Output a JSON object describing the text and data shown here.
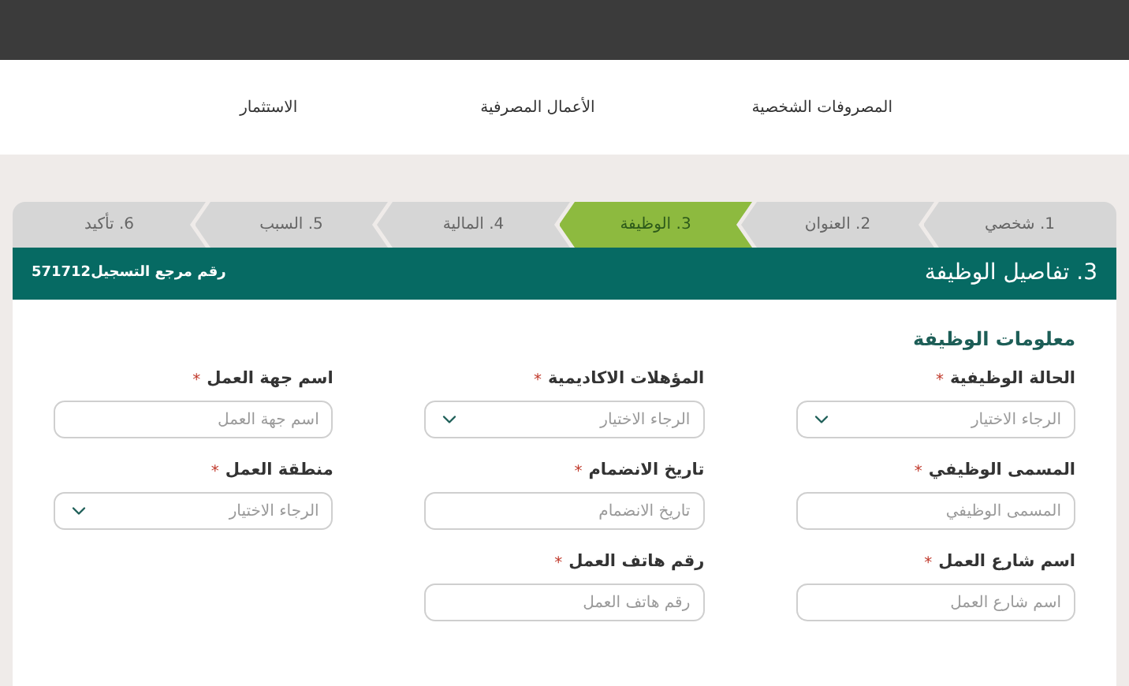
{
  "nav": [
    {
      "label": "المصروفات الشخصية"
    },
    {
      "label": "الأعمال المصرفية"
    },
    {
      "label": "الاستثمار"
    }
  ],
  "steps": [
    {
      "label": "1. شخصي",
      "selected": false
    },
    {
      "label": "2. العنوان",
      "selected": false
    },
    {
      "label": "3. الوظيفة",
      "selected": true
    },
    {
      "label": "4. المالية",
      "selected": false
    },
    {
      "label": "5. السبب",
      "selected": false
    },
    {
      "label": "6. تأكيد",
      "selected": false
    }
  ],
  "banner": {
    "title": "3. تفاصيل الوظيفة",
    "reference": "رقم مرجع التسجيل571712"
  },
  "section_title": "معلومات الوظيفة",
  "fields": [
    {
      "kind": "select",
      "label": "الحالة الوظيفية",
      "required_mark": "*",
      "placeholder": "الرجاء الاختيار"
    },
    {
      "kind": "select",
      "label": "المؤهلات الاكاديمية",
      "required_mark": "*",
      "placeholder": "الرجاء الاختيار"
    },
    {
      "kind": "text",
      "label": "اسم جهة العمل",
      "required_mark": "*",
      "placeholder": "اسم جهة العمل"
    },
    {
      "kind": "text",
      "label": "المسمى الوظيفي",
      "required_mark": "*",
      "placeholder": "المسمى الوظيفي"
    },
    {
      "kind": "text",
      "label": "تاريخ الانضمام",
      "required_mark": "*",
      "placeholder": "تاريخ الانضمام"
    },
    {
      "kind": "select",
      "label": "منطقة العمل",
      "required_mark": "*",
      "placeholder": "الرجاء الاختيار"
    },
    {
      "kind": "text",
      "label": "اسم شارع العمل",
      "required_mark": "*",
      "placeholder": "اسم شارع العمل"
    },
    {
      "kind": "text",
      "label": "رقم هاتف العمل",
      "required_mark": "*",
      "placeholder": "رقم هاتف العمل"
    }
  ]
}
